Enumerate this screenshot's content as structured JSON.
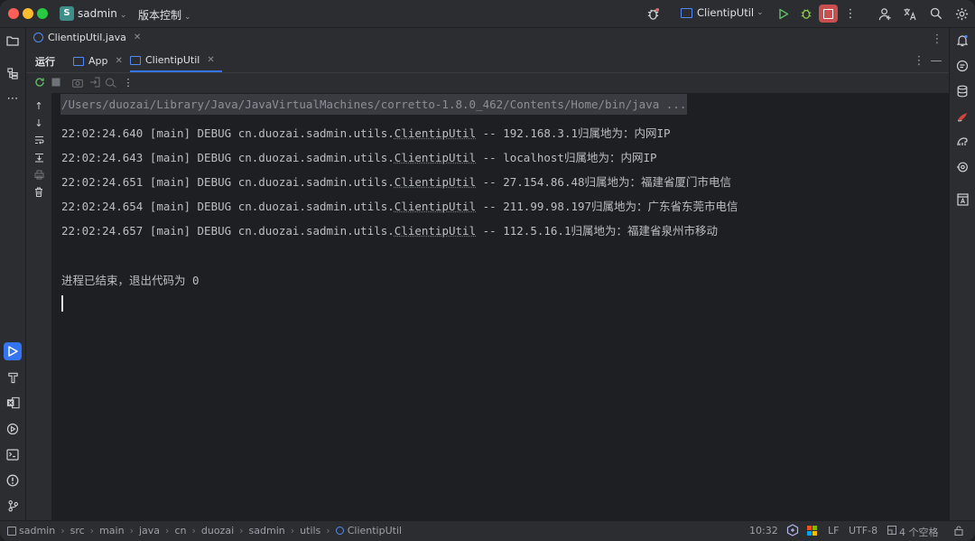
{
  "titlebar": {
    "project_badge": "S",
    "project_name": "sadmin",
    "vcs_label": "版本控制",
    "run_config": "ClientipUtil"
  },
  "editor_tabs": [
    {
      "label": "ClientipUtil.java",
      "icon": "java-class-icon"
    }
  ],
  "run_panel": {
    "title": "运行",
    "tabs": [
      {
        "label": "App",
        "active": false
      },
      {
        "label": "ClientipUtil",
        "active": true
      }
    ]
  },
  "console": {
    "command_line": "/Users/duozai/Library/Java/JavaVirtualMachines/corretto-1.8.0_462/Contents/Home/bin/java ...",
    "log_lines": [
      {
        "time": "22:02:24.640",
        "thread": "[main]",
        "level": "DEBUG",
        "pkg": "cn.duozai.sadmin.utils.",
        "cls": "ClientipUtil",
        "msg": " -- 192.168.3.1归属地为：内网IP"
      },
      {
        "time": "22:02:24.643",
        "thread": "[main]",
        "level": "DEBUG",
        "pkg": "cn.duozai.sadmin.utils.",
        "cls": "ClientipUtil",
        "msg": " -- localhost归属地为：内网IP"
      },
      {
        "time": "22:02:24.651",
        "thread": "[main]",
        "level": "DEBUG",
        "pkg": "cn.duozai.sadmin.utils.",
        "cls": "ClientipUtil",
        "msg": " -- 27.154.86.48归属地为：福建省厦门市电信"
      },
      {
        "time": "22:02:24.654",
        "thread": "[main]",
        "level": "DEBUG",
        "pkg": "cn.duozai.sadmin.utils.",
        "cls": "ClientipUtil",
        "msg": " -- 211.99.98.197归属地为：广东省东莞市电信"
      },
      {
        "time": "22:02:24.657",
        "thread": "[main]",
        "level": "DEBUG",
        "pkg": "cn.duozai.sadmin.utils.",
        "cls": "ClientipUtil",
        "msg": " -- 112.5.16.1归属地为：福建省泉州市移动"
      }
    ],
    "exit_message": "进程已结束，退出代码为 0"
  },
  "statusbar": {
    "breadcrumbs": [
      "sadmin",
      "src",
      "main",
      "java",
      "cn",
      "duozai",
      "sadmin",
      "utils",
      "ClientipUtil"
    ],
    "cursor_pos": "10:32",
    "line_sep": "LF",
    "encoding": "UTF-8",
    "indent": "4 个空格"
  },
  "colors": {
    "accent": "#3574f0",
    "stop_button": "#c94f4f",
    "run_green": "#5fb865",
    "debug_green": "#8fc74a"
  }
}
